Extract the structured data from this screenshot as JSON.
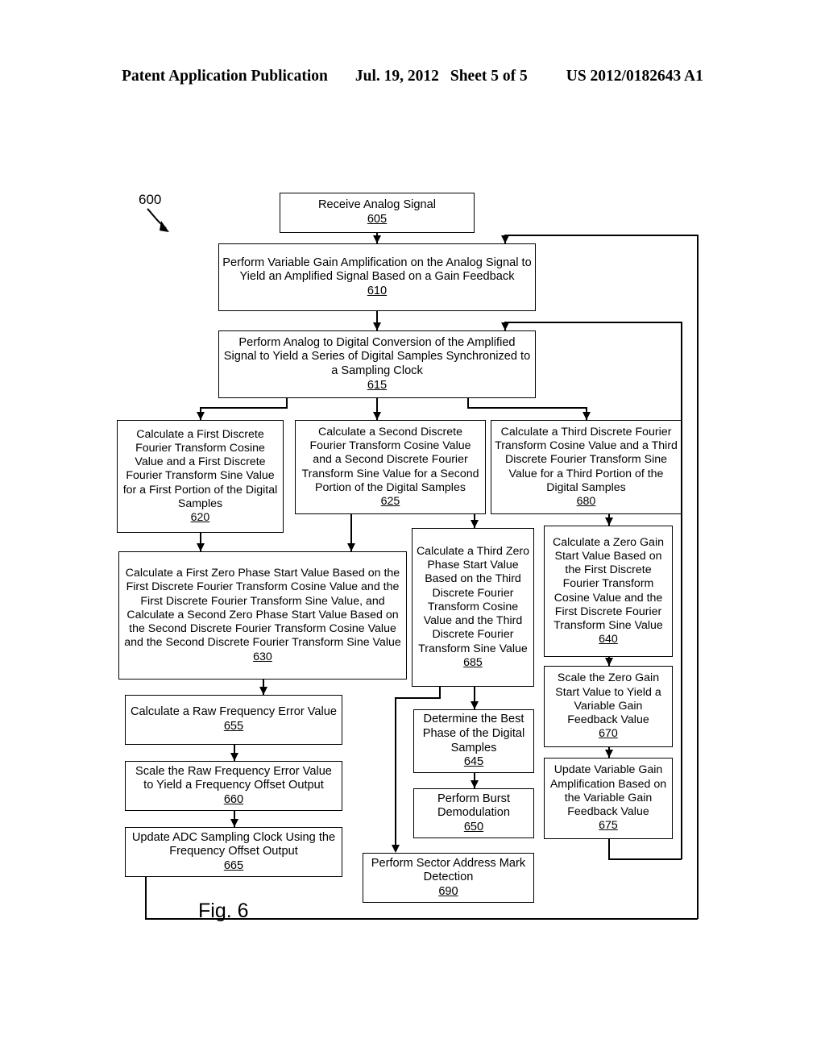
{
  "header": {
    "publication": "Patent Application Publication",
    "date": "Jul. 19, 2012",
    "sheet": "Sheet 5 of 5",
    "patent_number": "US 2012/0182643 A1"
  },
  "figure": {
    "label": "Fig. 6",
    "diagram_ref": "600"
  },
  "nodes": {
    "n605": {
      "text": "Receive Analog Signal",
      "num": "605"
    },
    "n610": {
      "text": "Perform Variable Gain Amplification on the Analog Signal to Yield an Amplified Signal Based on a Gain Feedback",
      "num": "610"
    },
    "n615": {
      "text": "Perform Analog to Digital Conversion of the Amplified Signal to Yield a Series of Digital Samples Synchronized to a Sampling Clock",
      "num": "615"
    },
    "n620": {
      "text": "Calculate a First Discrete Fourier Transform Cosine Value and a First Discrete Fourier Transform Sine Value for a First Portion of the Digital Samples",
      "num": "620"
    },
    "n625": {
      "text": "Calculate a Second Discrete Fourier Transform Cosine Value and a Second Discrete Fourier Transform Sine Value for a Second Portion of the Digital Samples",
      "num": "625"
    },
    "n680": {
      "text": "Calculate a Third Discrete Fourier Transform Cosine Value and a Third Discrete Fourier Transform Sine Value for a Third Portion of the Digital Samples",
      "num": "680"
    },
    "n630": {
      "text": "Calculate a First Zero Phase Start Value Based on the First Discrete Fourier Transform Cosine Value and the First Discrete Fourier Transform Sine Value, and Calculate a Second Zero Phase Start Value Based on the Second Discrete Fourier Transform Cosine Value and the Second Discrete Fourier Transform Sine Value",
      "num": "630"
    },
    "n685": {
      "text": "Calculate a Third Zero Phase Start Value Based on the Third Discrete Fourier Transform Cosine Value and the Third Discrete Fourier Transform Sine Value",
      "num": "685"
    },
    "n640": {
      "text": "Calculate a Zero Gain Start Value Based on the First Discrete Fourier Transform Cosine Value and the First Discrete Fourier Transform Sine Value",
      "num": "640"
    },
    "n670": {
      "text": "Scale the Zero Gain Start Value to Yield a Variable Gain Feedback Value",
      "num": "670"
    },
    "n675": {
      "text": "Update Variable Gain Amplification Based on the Variable Gain Feedback Value",
      "num": "675"
    },
    "n655": {
      "text": "Calculate a Raw Frequency Error Value",
      "num": "655"
    },
    "n660": {
      "text": "Scale the Raw Frequency Error Value to Yield a Frequency Offset Output",
      "num": "660"
    },
    "n665": {
      "text": "Update ADC Sampling Clock Using the Frequency Offset Output",
      "num": "665"
    },
    "n645": {
      "text": "Determine the Best Phase of the Digital Samples",
      "num": "645"
    },
    "n650": {
      "text": "Perform Burst Demodulation",
      "num": "650"
    },
    "n690": {
      "text": "Perform Sector Address Mark Detection",
      "num": "690"
    }
  }
}
